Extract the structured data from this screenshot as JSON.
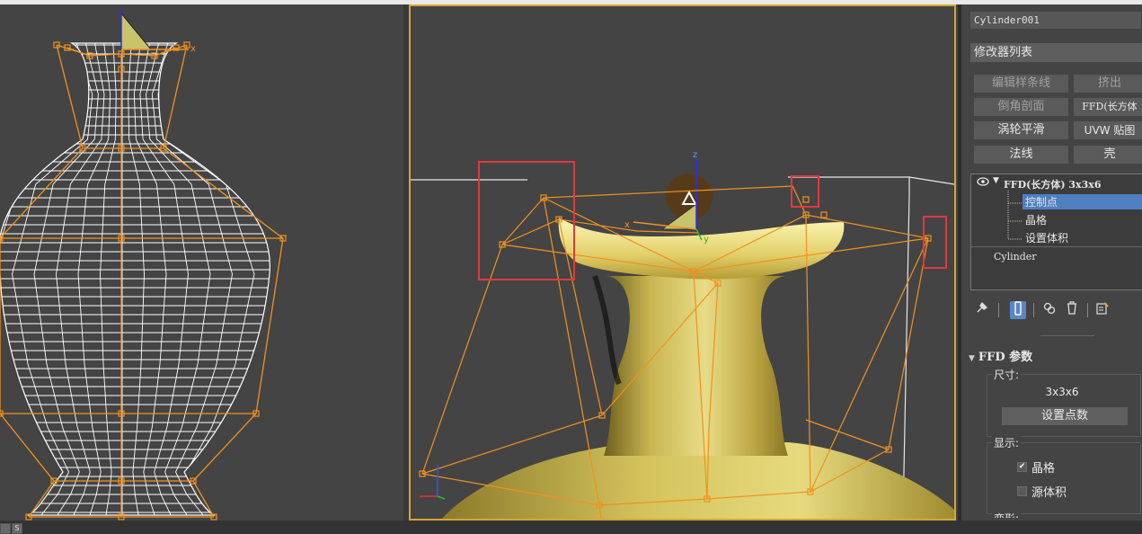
{
  "panel": {
    "object_name": "Cylinder001",
    "modifier_list": "修改器列表",
    "buttons": [
      {
        "label": "编辑样条线",
        "enabled": false
      },
      {
        "label": "挤出",
        "enabled": false
      },
      {
        "label": "倒角剖面",
        "enabled": false
      },
      {
        "label": "FFD(长方体",
        "enabled": true
      },
      {
        "label": "涡轮平滑",
        "enabled": true
      },
      {
        "label": "UVW 贴图",
        "enabled": true
      },
      {
        "label": "法线",
        "enabled": true
      },
      {
        "label": "壳",
        "enabled": true
      }
    ],
    "stack": {
      "modifier": "FFD(长方体) 3x3x6",
      "sub_items": [
        "控制点",
        "晶格",
        "设置体积"
      ],
      "selected_sub": "控制点",
      "base": "Cylinder"
    },
    "rollout": {
      "title": "FFD 参数",
      "dimensions_label": "尺寸:",
      "dimensions_value": "3x3x6",
      "set_points_button": "设置点数",
      "display_label": "显示:",
      "lattice_label": "晶格",
      "lattice_checked": true,
      "source_volume_label": "源体积",
      "source_volume_checked": false,
      "next_label": "变形:"
    }
  },
  "colors": {
    "lattice": "#f0921e",
    "wireframe": "#ffffff",
    "vase": "#d8c65a",
    "viewport_bg": "#444444",
    "active_border": "#d6a531",
    "highlight_box": "#e0393e",
    "selection": "#4f7fbf"
  },
  "viewport": {
    "gizmo_axes": [
      "x",
      "y",
      "z"
    ]
  }
}
